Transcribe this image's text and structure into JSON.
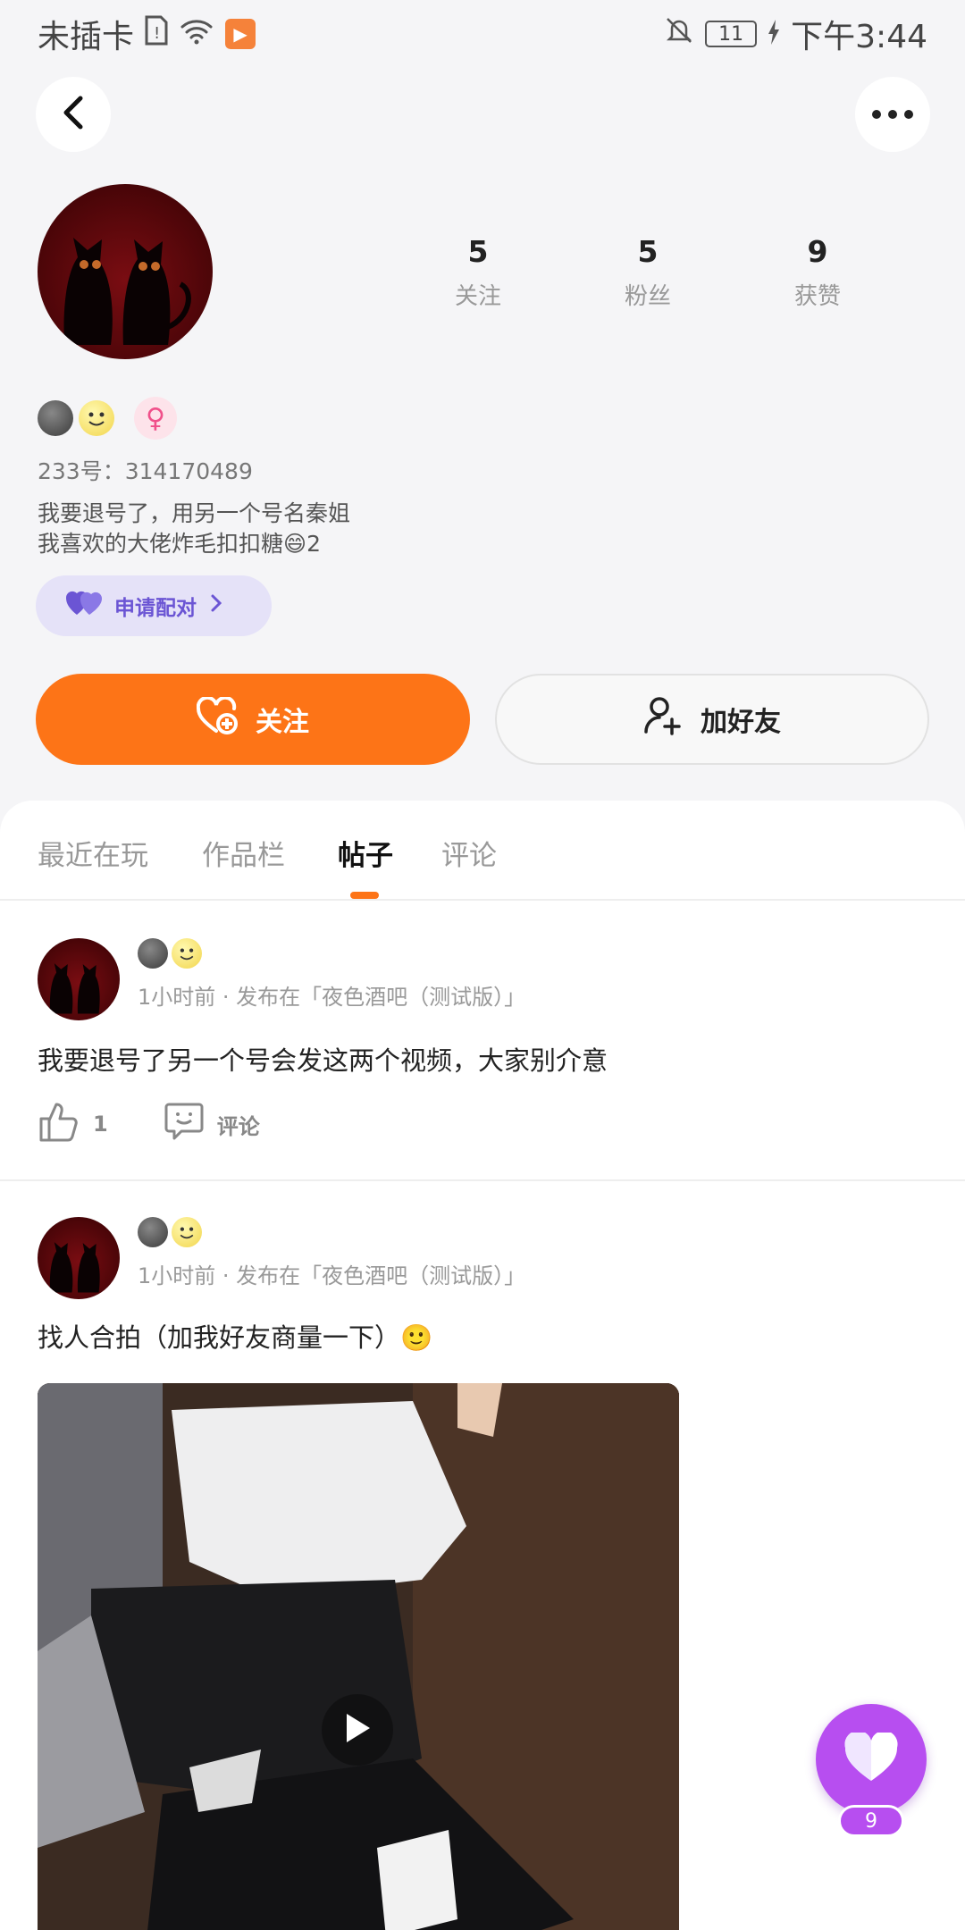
{
  "status_bar": {
    "carrier": "未插卡",
    "battery": "11",
    "time": "下午3:44"
  },
  "profile": {
    "stats": [
      {
        "value": "5",
        "label": "关注"
      },
      {
        "value": "5",
        "label": "粉丝"
      },
      {
        "value": "9",
        "label": "获赞"
      }
    ],
    "gender_symbol": "♀",
    "uid": "233号：314170489",
    "bio_line1": "我要退号了，用另一个号名秦姐",
    "bio_line2": "我喜欢的大佬炸毛扣扣糖😄2",
    "pair_label": "申请配对",
    "follow_label": "关注",
    "add_friend_label": "加好友"
  },
  "tabs": [
    {
      "label": "最近在玩",
      "active": false
    },
    {
      "label": "作品栏",
      "active": false
    },
    {
      "label": "帖子",
      "active": true
    },
    {
      "label": "评论",
      "active": false
    }
  ],
  "posts": [
    {
      "meta": "1小时前 · 发布在「夜色酒吧（测试版）」",
      "text": "我要退号了另一个号会发这两个视频，大家别介意",
      "likes": "1",
      "comment_label": "评论"
    },
    {
      "meta": "1小时前 · 发布在「夜色酒吧（测试版）」",
      "text": "找人合拍（加我好友商量一下）🙂"
    }
  ],
  "fab": {
    "count": "9"
  },
  "colors": {
    "accent_orange": "#fd7417",
    "pair_purple": "#6b55d4",
    "fab_purple": "#b74ef0"
  }
}
